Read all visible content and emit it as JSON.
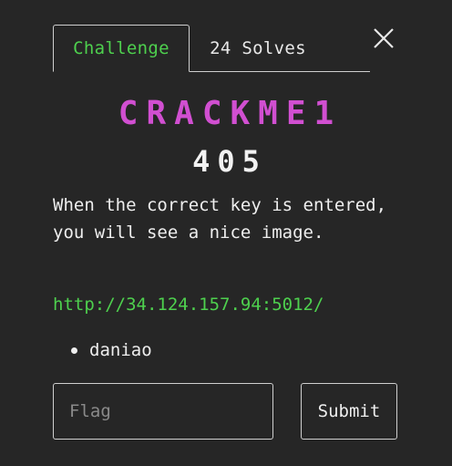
{
  "tabs": [
    {
      "label": "Challenge",
      "active": true
    },
    {
      "label": "24 Solves",
      "active": false
    }
  ],
  "close_icon": "close-icon",
  "challenge": {
    "name": "CRACKME1",
    "points": "405",
    "description": "When the correct key is entered, you will see a nice image.",
    "link": "http://34.124.157.94:5012/",
    "files": [
      "daniao"
    ]
  },
  "form": {
    "flag_placeholder": "Flag",
    "flag_value": "",
    "submit_label": "Submit"
  },
  "colors": {
    "background": "#262626",
    "accent_green": "#4ed04e",
    "title_magenta": "#d14fd1",
    "text": "#eeeeee",
    "border": "#cfcfcf"
  }
}
